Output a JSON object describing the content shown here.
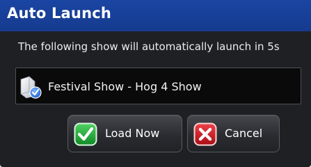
{
  "dialog": {
    "title": "Auto Launch",
    "message": "The following show will automatically launch in 5s",
    "show": {
      "name": "Festival Show - Hog 4 Show",
      "icon": "document-check-icon"
    },
    "buttons": {
      "load_now": {
        "label": "Load Now",
        "icon": "green-check-icon"
      },
      "cancel": {
        "label": "Cancel",
        "icon": "red-x-icon"
      }
    }
  },
  "colors": {
    "titlebar": "#1a45a3",
    "background": "#1f2024",
    "showbox": "#0a0a0b",
    "check_green": "#1fa83a",
    "cancel_red": "#c8161d"
  }
}
